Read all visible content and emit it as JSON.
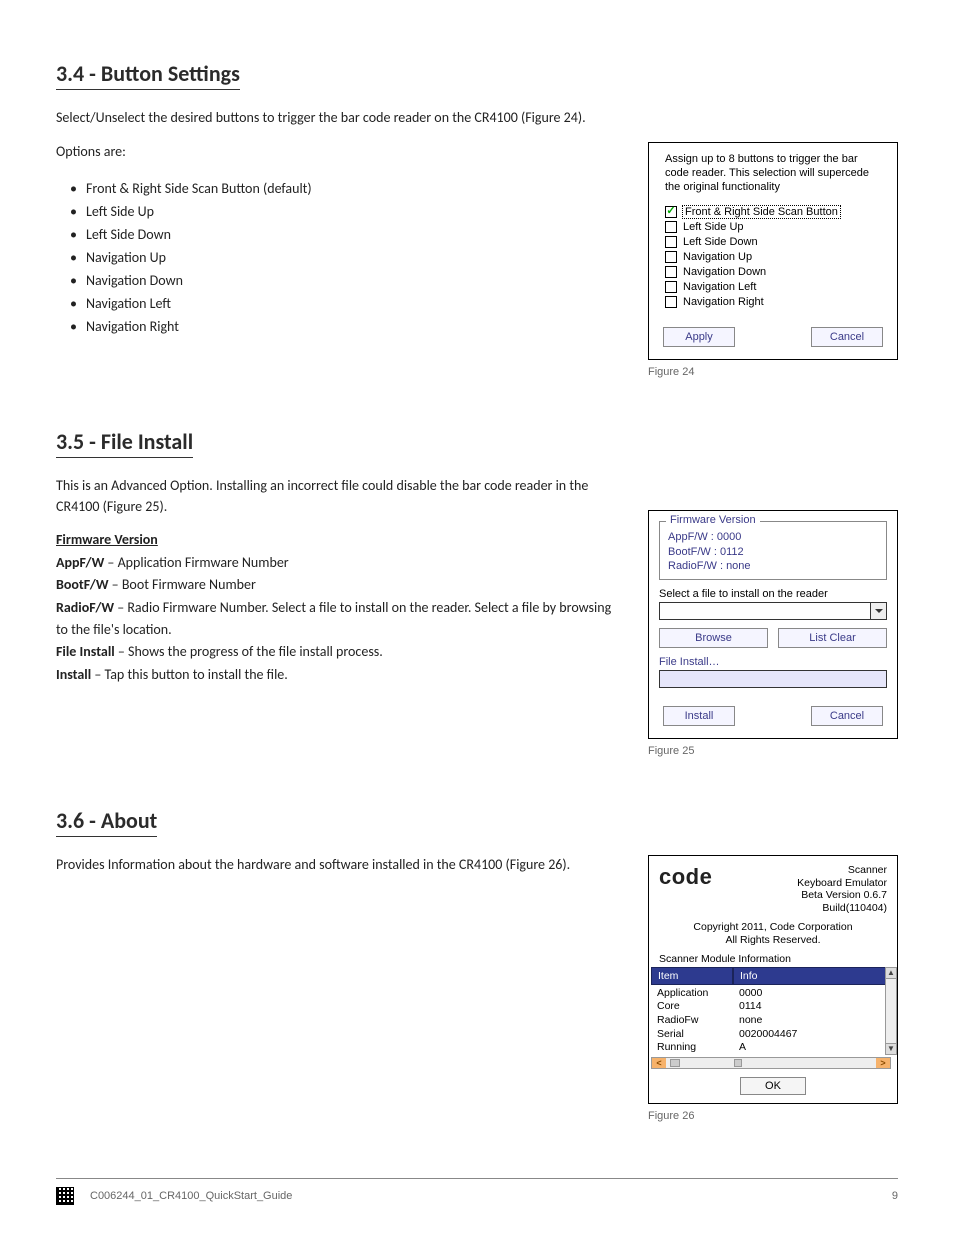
{
  "section34": {
    "heading": "3.4 - Button Settings",
    "intro": "Select/Unselect the desired buttons to trigger the bar code reader on the CR4100 (Figure 24).",
    "options_label": "Options are:",
    "options": [
      "Front & Right Side Scan Button (default)",
      "Left Side Up",
      "Left Side Down",
      "Navigation Up",
      "Navigation Down",
      "Navigation Left",
      "Navigation Right"
    ]
  },
  "fig24": {
    "desc": "Assign up to 8 buttons to trigger the bar code reader. This selection will supercede the original functionality",
    "items": [
      {
        "label": "Front & Right Side Scan Button",
        "checked": true,
        "selected": true
      },
      {
        "label": "Left Side Up",
        "checked": false,
        "selected": false
      },
      {
        "label": "Left Side Down",
        "checked": false,
        "selected": false
      },
      {
        "label": "Navigation Up",
        "checked": false,
        "selected": false
      },
      {
        "label": "Navigation Down",
        "checked": false,
        "selected": false
      },
      {
        "label": "Navigation Left",
        "checked": false,
        "selected": false
      },
      {
        "label": "Navigation Right",
        "checked": false,
        "selected": false
      }
    ],
    "apply": "Apply",
    "cancel": "Cancel",
    "caption": "Figure 24"
  },
  "section35": {
    "heading": "3.5 - File Install",
    "intro": "This is an Advanced Option.  Installing an incorrect file could disable the bar code reader in the CR4100 (Figure 25).",
    "fw_heading": "Firmware Version",
    "lines": [
      {
        "b": "AppF/W",
        "rest": " – Application Firmware Number"
      },
      {
        "b": "BootF/W",
        "rest": " – Boot Firmware Number"
      },
      {
        "b": "RadioF/W",
        "rest": " – Radio Firmware Number. Select a file to install on the reader. Select a file by browsing to the file's location."
      },
      {
        "b": "File Install",
        "rest": " – Shows the progress of the file install process."
      },
      {
        "b": "Install",
        "rest": " – Tap this button to install the file."
      }
    ]
  },
  "fig25": {
    "legend": "Firmware Version",
    "appfw": "AppF/W : 0000",
    "bootfw": "BootF/W : 0112",
    "radiofw": "RadioF/W : none",
    "select_label": "Select a file to install on the reader",
    "browse": "Browse",
    "list_clear": "List Clear",
    "file_install_label": "File Install…",
    "install": "Install",
    "cancel": "Cancel",
    "caption": "Figure 25"
  },
  "section36": {
    "heading": "3.6 - About",
    "intro": "Provides Information about the hardware and software installed in the CR4100 (Figure 26)."
  },
  "fig26": {
    "logo": "code",
    "title1": "Scanner",
    "title2": "Keyboard Emulator",
    "title3": "Beta Version 0.6.7",
    "title4": "Build(110404)",
    "copyright1": "Copyright  2011, Code Corporation",
    "copyright2": "All Rights Reserved.",
    "sub": "Scanner Module Information",
    "th_item": "Item",
    "th_info": "Info",
    "rows": [
      {
        "item": "Application",
        "info": "0000"
      },
      {
        "item": "Core",
        "info": "0114"
      },
      {
        "item": "RadioFw",
        "info": "none"
      },
      {
        "item": "Serial",
        "info": "0020004467"
      },
      {
        "item": "Running",
        "info": "A"
      }
    ],
    "ok": "OK",
    "caption": "Figure 26"
  },
  "footer": {
    "doc": "C006244_01_CR4100_QuickStart_Guide",
    "page": "9"
  }
}
